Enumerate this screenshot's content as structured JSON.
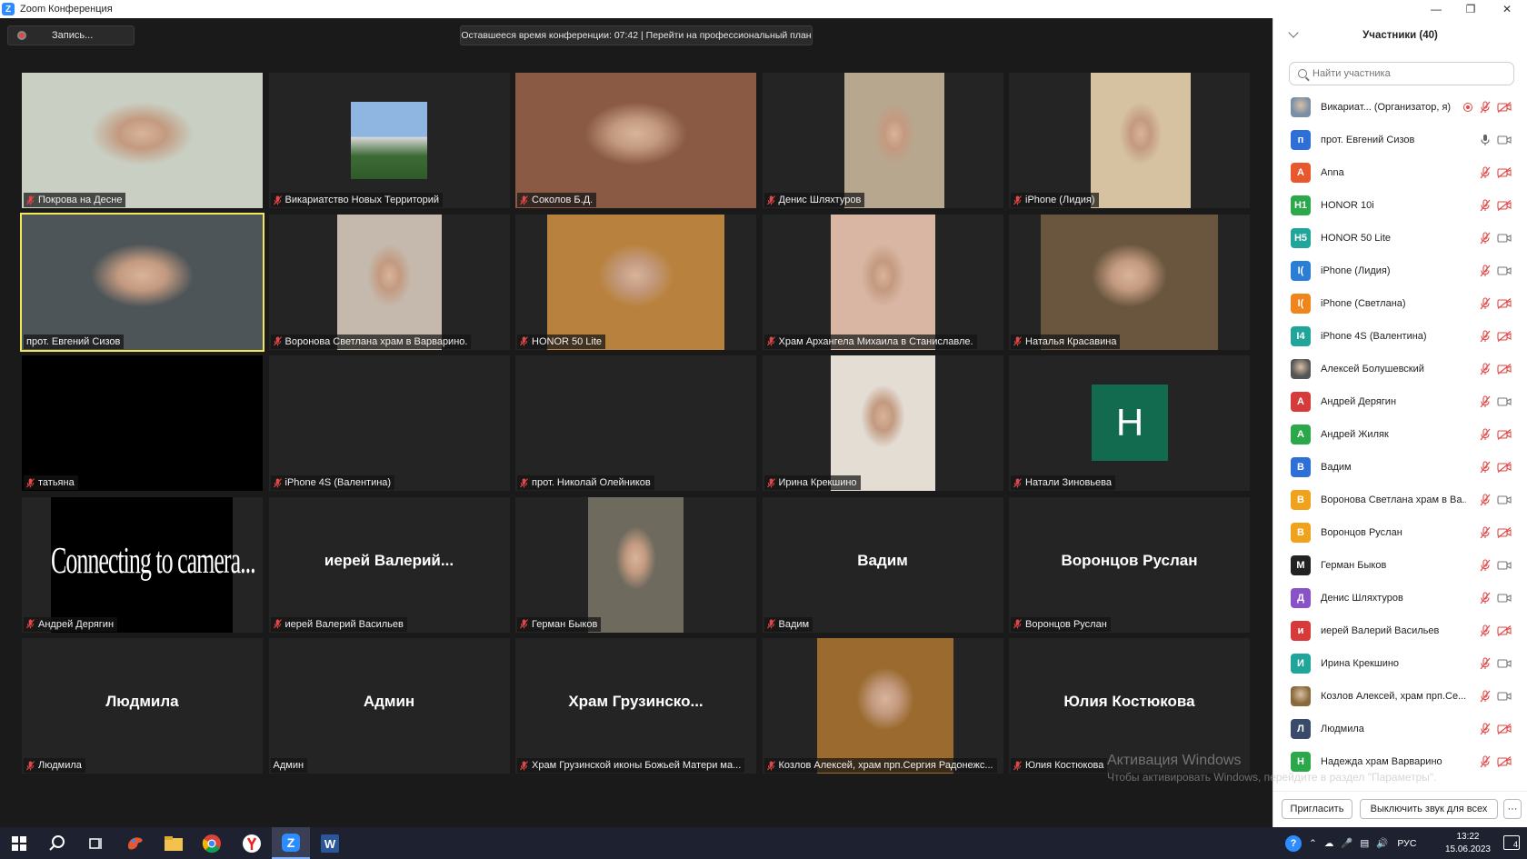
{
  "window": {
    "title": "Zoom Конференция",
    "controls": [
      "minimize",
      "restore",
      "close"
    ]
  },
  "meeting": {
    "record_label": "Запись...",
    "time_banner": "Оставшееся время конференции: 07:42 | Перейти на профессиональный план"
  },
  "tiles": [
    {
      "name": "Покрова на Десне",
      "muted": true,
      "kind": "video",
      "tone": "#c9cfc2"
    },
    {
      "name": "Викариатство Новых Территорий",
      "muted": true,
      "kind": "image",
      "tone": "#5c7fa3"
    },
    {
      "name": "Соколов Б.Д.",
      "muted": true,
      "kind": "video",
      "tone": "#8a5a44"
    },
    {
      "name": "Денис Шляхтуров",
      "muted": true,
      "kind": "video",
      "tone": "#b7a78f"
    },
    {
      "name": "iPhone (Лидия)",
      "muted": true,
      "kind": "video",
      "tone": "#d6c2a0"
    },
    {
      "name": "прот. Евгений Сизов",
      "muted": false,
      "kind": "video",
      "tone": "#4e5558",
      "active": true
    },
    {
      "name": "Воронова Светлана храм в Варварино.",
      "muted": true,
      "kind": "video",
      "tone": "#c5b9ad"
    },
    {
      "name": "HONOR 50 Lite",
      "muted": true,
      "kind": "video",
      "tone": "#b8823e"
    },
    {
      "name": "Храм Архангела Михаила в Станиславле.",
      "muted": true,
      "kind": "video",
      "tone": "#d9b6a3"
    },
    {
      "name": "Наталья Красавина",
      "muted": true,
      "kind": "video",
      "tone": "#6a563e"
    },
    {
      "name": "татьяна",
      "muted": true,
      "kind": "black"
    },
    {
      "name": "iPhone 4S (Валентина)",
      "muted": true,
      "kind": "empty"
    },
    {
      "name": "прот. Николай Олейников",
      "muted": true,
      "kind": "empty"
    },
    {
      "name": "Ирина Крекшино",
      "muted": true,
      "kind": "video",
      "tone": "#e3ddd4"
    },
    {
      "name": "Натали Зиновьева",
      "muted": true,
      "kind": "avatar",
      "avatar_letter": "Н"
    },
    {
      "name": "Андрей Дерягин",
      "muted": true,
      "kind": "connecting",
      "overlay_text": "Connecting to camera..."
    },
    {
      "name": "иерей Валерий Васильев",
      "muted": true,
      "kind": "name",
      "big_name": "иерей Валерий..."
    },
    {
      "name": "Герман Быков",
      "muted": true,
      "kind": "video",
      "tone": "#6e6a5e"
    },
    {
      "name": "Вадим",
      "muted": true,
      "kind": "name",
      "big_name": "Вадим"
    },
    {
      "name": "Воронцов Руслан",
      "muted": true,
      "kind": "name",
      "big_name": "Воронцов Руслан"
    },
    {
      "name": "Людмила",
      "muted": true,
      "kind": "name",
      "big_name": "Людмила"
    },
    {
      "name": "Админ",
      "muted": false,
      "kind": "name",
      "big_name": "Админ"
    },
    {
      "name": "Храм Грузинской иконы Божьей Матери  ма...",
      "muted": true,
      "kind": "name",
      "big_name": "Храм  Грузинско..."
    },
    {
      "name": "Козлов Алексей, храм прп.Сергия Радонежс...",
      "muted": true,
      "kind": "video",
      "tone": "#9a6a2e"
    },
    {
      "name": "Юлия Костюкова",
      "muted": true,
      "kind": "name",
      "big_name": "Юлия Костюкова"
    }
  ],
  "participants_panel": {
    "title": "Участники (40)",
    "search_placeholder": "Найти участника",
    "items": [
      {
        "avatar": "",
        "avatar_color": "#7a8fa6",
        "photo": true,
        "name": "Викариат... (Организатор, я)",
        "mic": "muted",
        "cam": "off",
        "extra": "record"
      },
      {
        "avatar": "п",
        "avatar_color": "#2d6fd6",
        "name": "прот. Евгений Сизов",
        "mic": "on",
        "cam": "on"
      },
      {
        "avatar": "А",
        "avatar_color": "#e8572d",
        "name": "Anna",
        "mic": "muted",
        "cam": "off"
      },
      {
        "avatar": "H1",
        "avatar_color": "#2aa84a",
        "name": "HONOR 10i",
        "mic": "muted",
        "cam": "off"
      },
      {
        "avatar": "H5",
        "avatar_color": "#1fa59a",
        "name": "HONOR 50 Lite",
        "mic": "muted",
        "cam": "on"
      },
      {
        "avatar": "I(",
        "avatar_color": "#2a7fd4",
        "name": "iPhone (Лидия)",
        "mic": "muted",
        "cam": "on"
      },
      {
        "avatar": "I(",
        "avatar_color": "#f0851c",
        "name": "iPhone (Светлана)",
        "mic": "muted",
        "cam": "off"
      },
      {
        "avatar": "I4",
        "avatar_color": "#1fa59a",
        "name": "iPhone 4S (Валентина)",
        "mic": "muted",
        "cam": "off"
      },
      {
        "avatar": "",
        "avatar_color": "#555555",
        "photo": true,
        "name": "Алексей Болушевский",
        "mic": "muted",
        "cam": "off"
      },
      {
        "avatar": "А",
        "avatar_color": "#d63a3a",
        "name": "Андрей Дерягин",
        "mic": "muted",
        "cam": "on"
      },
      {
        "avatar": "А",
        "avatar_color": "#2aa84a",
        "name": "Андрей Жиляк",
        "mic": "muted",
        "cam": "off"
      },
      {
        "avatar": "В",
        "avatar_color": "#2d6fd6",
        "name": "Вадим",
        "mic": "muted",
        "cam": "off"
      },
      {
        "avatar": "В",
        "avatar_color": "#f0a21c",
        "name": "Воронова Светлана храм в Ва...",
        "mic": "muted",
        "cam": "on"
      },
      {
        "avatar": "В",
        "avatar_color": "#f0a21c",
        "name": "Воронцов Руслан",
        "mic": "muted",
        "cam": "off"
      },
      {
        "avatar": "M",
        "avatar_color": "#222222",
        "name": "Герман Быков",
        "mic": "muted",
        "cam": "on"
      },
      {
        "avatar": "Д",
        "avatar_color": "#8a52c9",
        "name": "Денис Шляхтуров",
        "mic": "muted",
        "cam": "on"
      },
      {
        "avatar": "и",
        "avatar_color": "#d63a3a",
        "name": "иерей Валерий Васильев",
        "mic": "muted",
        "cam": "off"
      },
      {
        "avatar": "И",
        "avatar_color": "#1fa59a",
        "name": "Ирина Крекшино",
        "mic": "muted",
        "cam": "on"
      },
      {
        "avatar": "",
        "avatar_color": "#8a6a3a",
        "photo": true,
        "name": "Козлов Алексей, храм прп.Се...",
        "mic": "muted",
        "cam": "on"
      },
      {
        "avatar": "Л",
        "avatar_color": "#3a4a6a",
        "name": "Людмила",
        "mic": "muted",
        "cam": "off"
      },
      {
        "avatar": "Н",
        "avatar_color": "#2aa84a",
        "name": "Надежда храм Варварино",
        "mic": "muted",
        "cam": "off"
      }
    ],
    "invite_label": "Пригласить",
    "mute_all_label": "Выключить звук для всех",
    "more_label": "···"
  },
  "watermark": {
    "line1": "Активация Windows",
    "line2": "Чтобы активировать Windows, перейдите в раздел \"Параметры\"."
  },
  "taskbar": {
    "icons": [
      "windows-start-icon",
      "search-icon",
      "task-view-icon",
      "paint-icon",
      "file-explorer-icon",
      "chrome-icon",
      "yandex-browser-icon",
      "zoom-icon",
      "word-icon"
    ],
    "language": "РУС",
    "time": "13:22",
    "date": "15.06.2023",
    "notifications_count": "4"
  }
}
